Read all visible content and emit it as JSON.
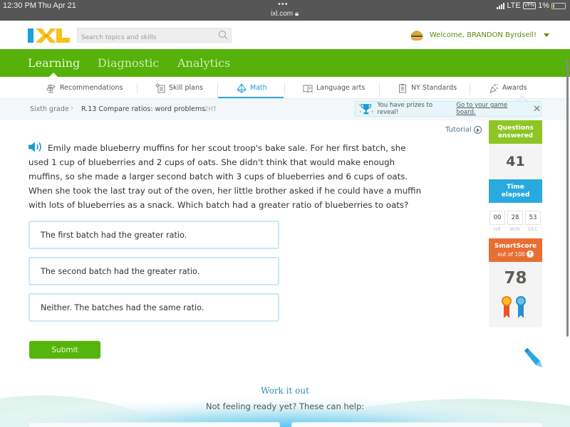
{
  "status_bar": {
    "time": "12:30 PM",
    "date": "Thu Apr 21",
    "dots": "•••",
    "url": "ixl.com",
    "network": "LTE",
    "vpn": "VPN",
    "battery": "1%"
  },
  "header": {
    "logo": "IXL",
    "search_placeholder": "Search topics and skills",
    "welcome": "Welcome, BRANDON Byrdsell!"
  },
  "main_nav": {
    "tabs": [
      {
        "label": "Learning",
        "active": true
      },
      {
        "label": "Diagnostic",
        "active": false
      },
      {
        "label": "Analytics",
        "active": false
      }
    ]
  },
  "sub_nav": {
    "items": [
      {
        "label": "Recommendations",
        "icon": "signpost-icon",
        "active": false
      },
      {
        "label": "Skill plans",
        "icon": "skill-plans-icon",
        "active": false
      },
      {
        "label": "Math",
        "icon": "pyramid-icon",
        "active": true
      },
      {
        "label": "Language arts",
        "icon": "book-icon",
        "active": false
      },
      {
        "label": "NY Standards",
        "icon": "clipboard-icon",
        "active": false
      },
      {
        "label": "Awards",
        "icon": "party-popper-icon",
        "active": false
      }
    ]
  },
  "breadcrumb": {
    "grade": "Sixth grade",
    "separator": "›",
    "skill": "R.13 Compare ratios: word problems",
    "code": "2HT"
  },
  "prize_banner": {
    "text": "You have prizes to reveal!",
    "link": "Go to your game board.",
    "close": "✕"
  },
  "tutorial": {
    "label": "Tutorial"
  },
  "question": {
    "text": "Emily made blueberry muffins for her scout troop's bake sale. For her first batch, she used 1 cup of blueberries and 2 cups of oats. She didn't think that would make enough muffins, so she made a larger second batch with 3 cups of blueberries and 6 cups of oats. When she took the last tray out of the oven, her little brother asked if he could have a muffin with lots of blueberries as a snack. Which batch had a greater ratio of blueberries to oats?",
    "choices": [
      "The first batch had the greater ratio.",
      "The second batch had the greater ratio.",
      "Neither. The batches had the same ratio."
    ],
    "submit": "Submit"
  },
  "sidebar": {
    "questions_answered": {
      "label_line1": "Questions",
      "label_line2": "answered",
      "value": "41"
    },
    "time_elapsed": {
      "label_line1": "Time",
      "label_line2": "elapsed",
      "hr": "00",
      "min": "28",
      "sec": "53",
      "hr_label": "HR",
      "min_label": "MIN",
      "sec_label": "SEC"
    },
    "smartscore": {
      "label": "SmartScore",
      "sub": "out of 100",
      "help": "?",
      "value": "78"
    }
  },
  "work_it_out": {
    "title": "Work it out",
    "subtitle": "Not feeling ready yet? These can help:"
  },
  "colors": {
    "brand_green": "#56b20a",
    "active_blue": "#1b9cd4",
    "questions_green": "#8fc524",
    "time_blue": "#29aadf",
    "smartscore_orange": "#e86e32"
  }
}
